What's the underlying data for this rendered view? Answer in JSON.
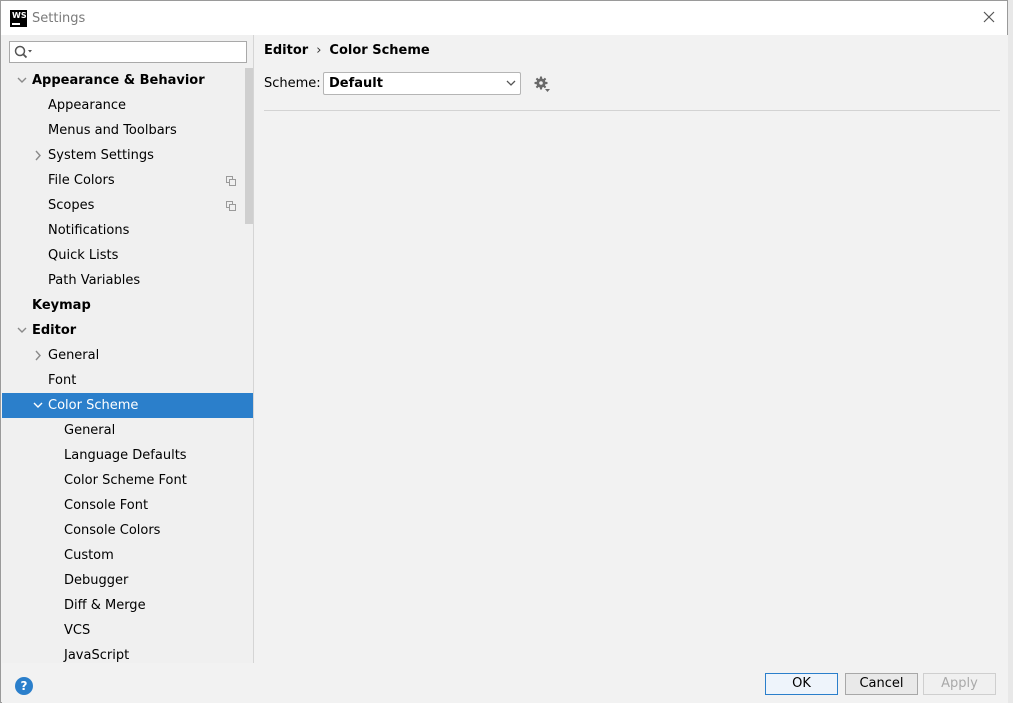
{
  "window": {
    "title": "Settings",
    "app_icon_text": "WS"
  },
  "search": {
    "placeholder": "",
    "value": ""
  },
  "sidebar": {
    "items": [
      {
        "label": "Appearance & Behavior",
        "level": 0,
        "bold": true,
        "arrow": "down",
        "selected": false,
        "copy_icon": false
      },
      {
        "label": "Appearance",
        "level": 1,
        "bold": false,
        "arrow": "",
        "selected": false,
        "copy_icon": false
      },
      {
        "label": "Menus and Toolbars",
        "level": 1,
        "bold": false,
        "arrow": "",
        "selected": false,
        "copy_icon": false
      },
      {
        "label": "System Settings",
        "level": 1,
        "bold": false,
        "arrow": "right",
        "selected": false,
        "copy_icon": false
      },
      {
        "label": "File Colors",
        "level": 1,
        "bold": false,
        "arrow": "",
        "selected": false,
        "copy_icon": true
      },
      {
        "label": "Scopes",
        "level": 1,
        "bold": false,
        "arrow": "",
        "selected": false,
        "copy_icon": true
      },
      {
        "label": "Notifications",
        "level": 1,
        "bold": false,
        "arrow": "",
        "selected": false,
        "copy_icon": false
      },
      {
        "label": "Quick Lists",
        "level": 1,
        "bold": false,
        "arrow": "",
        "selected": false,
        "copy_icon": false
      },
      {
        "label": "Path Variables",
        "level": 1,
        "bold": false,
        "arrow": "",
        "selected": false,
        "copy_icon": false
      },
      {
        "label": "Keymap",
        "level": 0,
        "bold": true,
        "arrow": "",
        "selected": false,
        "copy_icon": false
      },
      {
        "label": "Editor",
        "level": 0,
        "bold": true,
        "arrow": "down",
        "selected": false,
        "copy_icon": false
      },
      {
        "label": "General",
        "level": 1,
        "bold": false,
        "arrow": "right",
        "selected": false,
        "copy_icon": false
      },
      {
        "label": "Font",
        "level": 1,
        "bold": false,
        "arrow": "",
        "selected": false,
        "copy_icon": false
      },
      {
        "label": "Color Scheme",
        "level": 1,
        "bold": false,
        "arrow": "down",
        "selected": true,
        "copy_icon": false
      },
      {
        "label": "General",
        "level": 2,
        "bold": false,
        "arrow": "",
        "selected": false,
        "copy_icon": false
      },
      {
        "label": "Language Defaults",
        "level": 2,
        "bold": false,
        "arrow": "",
        "selected": false,
        "copy_icon": false
      },
      {
        "label": "Color Scheme Font",
        "level": 2,
        "bold": false,
        "arrow": "",
        "selected": false,
        "copy_icon": false
      },
      {
        "label": "Console Font",
        "level": 2,
        "bold": false,
        "arrow": "",
        "selected": false,
        "copy_icon": false
      },
      {
        "label": "Console Colors",
        "level": 2,
        "bold": false,
        "arrow": "",
        "selected": false,
        "copy_icon": false
      },
      {
        "label": "Custom",
        "level": 2,
        "bold": false,
        "arrow": "",
        "selected": false,
        "copy_icon": false
      },
      {
        "label": "Debugger",
        "level": 2,
        "bold": false,
        "arrow": "",
        "selected": false,
        "copy_icon": false
      },
      {
        "label": "Diff & Merge",
        "level": 2,
        "bold": false,
        "arrow": "",
        "selected": false,
        "copy_icon": false
      },
      {
        "label": "VCS",
        "level": 2,
        "bold": false,
        "arrow": "",
        "selected": false,
        "copy_icon": false
      },
      {
        "label": "JavaScript",
        "level": 2,
        "bold": false,
        "arrow": "",
        "selected": false,
        "copy_icon": false
      }
    ]
  },
  "main": {
    "breadcrumb": [
      "Editor",
      "Color Scheme"
    ],
    "breadcrumb_separator": "›",
    "scheme_label": "Scheme:",
    "scheme_value": "Default"
  },
  "footer": {
    "help_label": "?",
    "ok_label": "OK",
    "cancel_label": "Cancel",
    "apply_label": "Apply"
  },
  "colors": {
    "selection": "#2b7fcb",
    "window_bg": "#f2f2f2",
    "disabled_text": "#a9a9a9"
  }
}
